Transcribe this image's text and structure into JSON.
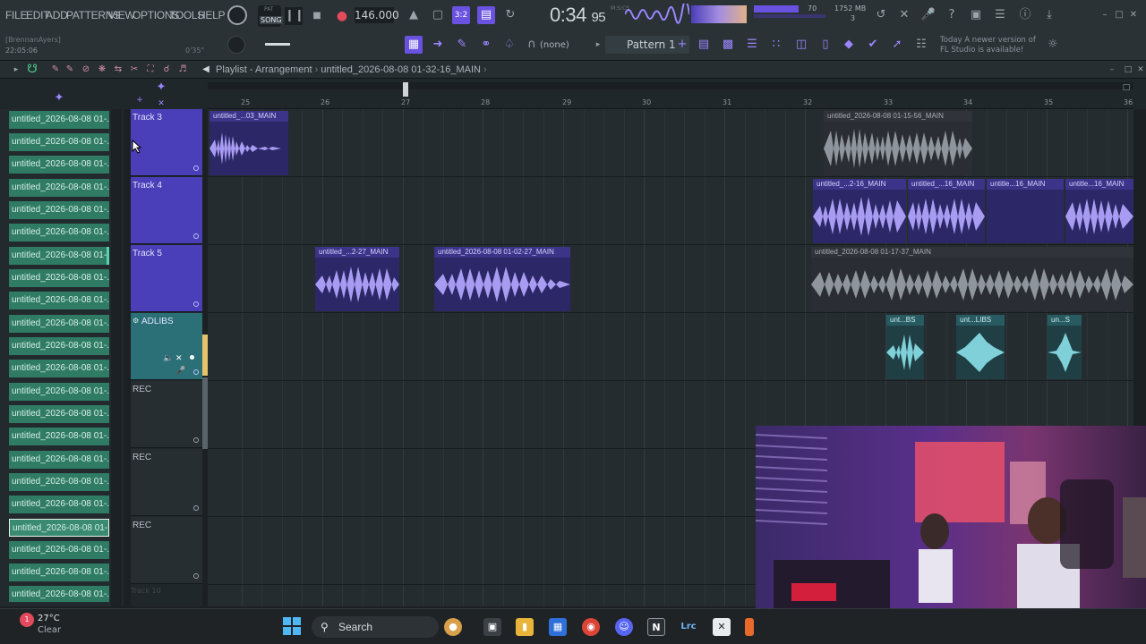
{
  "menu": [
    "FILE",
    "EDIT",
    "ADD",
    "PATTERNS",
    "VIEW",
    "OPTIONS",
    "TOOLS",
    "HELP"
  ],
  "user": "[BrennanAyers]",
  "clock_small": "22:05:06",
  "pat_song": {
    "pat": "PAT",
    "song": "SONG"
  },
  "tempo": "146.000",
  "time": {
    "main": "0:34",
    "sub": "95"
  },
  "time_label": "M:S:CS",
  "cpu_small": "0'35\"",
  "mem": "1752 MB",
  "mem_sub": "3",
  "level": "70",
  "snap": "(none)",
  "pattern": "Pattern 1",
  "news": {
    "line1": "Today   A newer version of",
    "line2": "FL Studio is available!"
  },
  "playlist": {
    "title": "Playlist - Arrangement",
    "file": "untitled_2026-08-08 01-32-16_MAIN"
  },
  "ruler": [
    "25",
    "26",
    "27",
    "28",
    "29",
    "30",
    "31",
    "32",
    "33",
    "34",
    "35",
    "36"
  ],
  "browser_items": [
    "untitled_2026-08-08 01-...",
    "untitled_2026-08-08 01-...",
    "untitled_2026-08-08 01-...",
    "untitled_2026-08-08 01-...",
    "untitled_2026-08-08 01-...",
    "untitled_2026-08-08 01-...",
    "untitled_2026-08-08 01-...",
    "untitled_2026-08-08 01-...",
    "untitled_2026-08-08 01-...",
    "untitled_2026-08-08 01-...",
    "untitled_2026-08-08 01-...",
    "untitled_2026-08-08 01-...",
    "untitled_2026-08-08 01-...",
    "untitled_2026-08-08 01-...",
    "untitled_2026-08-08 01-...",
    "untitled_2026-08-08 01-...",
    "untitled_2026-08-08 01-...",
    "untitled_2026-08-08 01-...",
    "untitled_2026-08-08 01-...",
    "untitled_2026-08-08 01-...",
    "untitled_2026-08-08 01-..."
  ],
  "tracks": [
    "Track 3",
    "Track 4",
    "Track 5",
    "ADLIBS",
    "REC",
    "REC",
    "REC"
  ],
  "track_10": "Track 10",
  "clips": {
    "t3a": "untitled_...03_MAIN",
    "t3b": "untitled_2026-08-08 01-15-56_MAIN",
    "t4a": "untitled_...2-16_MAIN",
    "t4b": "untitled_...16_MAIN",
    "t4c": "untitle...16_MAIN",
    "t4d": "untitle...16_MAIN",
    "t5a": "untitled_...2-27_MAIN",
    "t5b": "untitled_2026-08-08 01-02-27_MAIN",
    "t5c": "untitled_2026-08-08 01-17-37_MAIN",
    "ad1": "unt...BS",
    "ad2": "unt...LIBS",
    "ad3": "un...S"
  },
  "taskbar": {
    "search": "Search",
    "temp": "27°C",
    "cond": "Clear",
    "weather_badge": "1",
    "notion": "N",
    "lrc": "Lrc"
  },
  "colors": {
    "accent": "#6a52e0",
    "track_purple": "#4a3fb8",
    "browser_teal": "#2f7b64",
    "adlibs_teal": "#2b7076"
  }
}
